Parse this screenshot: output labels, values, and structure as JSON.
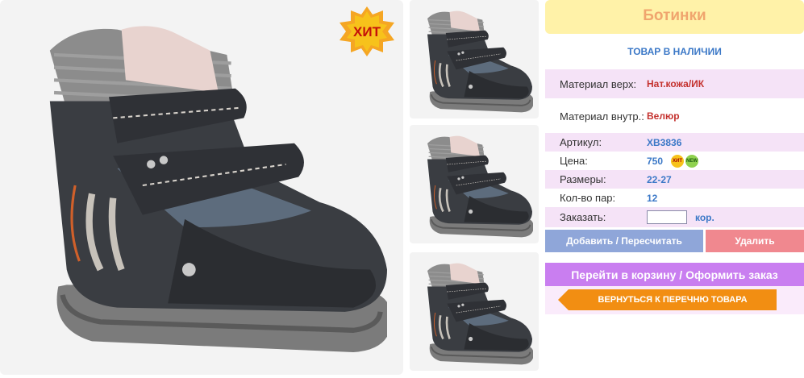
{
  "badge": {
    "label": "ХИТ"
  },
  "panel": {
    "title": "Ботинки",
    "stock_status": "ТОВАР В НАЛИЧИИ",
    "specs": [
      {
        "label": "Материал верх:",
        "value": "Нат.кожа/ИК"
      },
      {
        "label": "Материал внутр.:",
        "value": "Велюр"
      },
      {
        "label": "Артикул:",
        "value": "ХВ3836"
      },
      {
        "label": "Цена:",
        "value": "750"
      },
      {
        "label": "Размеры:",
        "value": "22-27"
      },
      {
        "label": "Кол-во пар:",
        "value": "12"
      }
    ],
    "price_badges": [
      "ХИТ",
      "NEW"
    ],
    "order": {
      "label": "Заказать:",
      "value": "",
      "unit": "кор."
    },
    "buttons": {
      "add": "Добавить / Пересчитать",
      "delete": "Удалить",
      "cart": "Перейти в корзину / Оформить заказ",
      "back": "ВЕРНУТЬСЯ К ПЕРЕЧНЮ ТОВАРА"
    }
  },
  "colors": {
    "title_bg": "#fff2a8",
    "title_text": "#f0a56e",
    "accent_blue": "#3b78c7",
    "add_button": "#8fa6d9",
    "delete_button": "#f0888f",
    "cart_button": "#c97ef0",
    "back_button": "#f28e12"
  }
}
